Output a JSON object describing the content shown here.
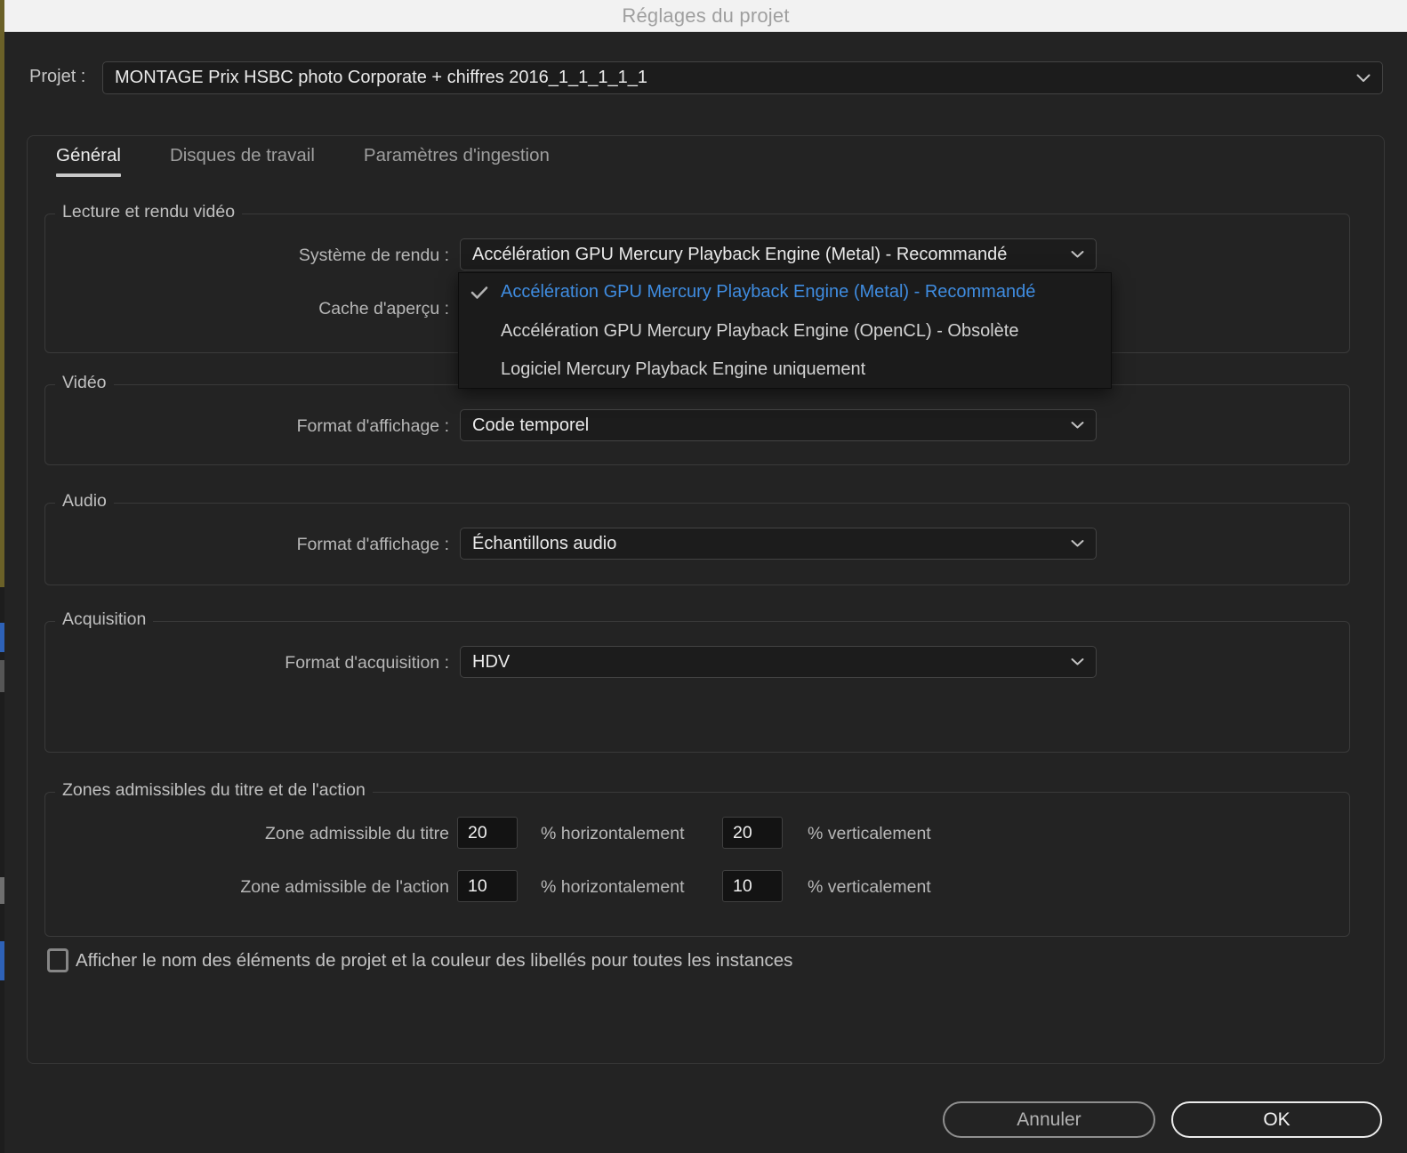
{
  "window": {
    "title": "Réglages du projet"
  },
  "project": {
    "label": "Projet :",
    "value": "MONTAGE Prix HSBC photo Corporate + chiffres 2016_1_1_1_1_1"
  },
  "tabs": [
    {
      "label": "Général",
      "active": true
    },
    {
      "label": "Disques de travail",
      "active": false
    },
    {
      "label": "Paramètres d'ingestion",
      "active": false
    }
  ],
  "playback": {
    "legend": "Lecture et rendu vidéo",
    "renderer_label": "Système de rendu :",
    "renderer_value": "Accélération GPU Mercury Playback Engine (Metal) - Recommandé",
    "cache_label": "Cache d'aperçu :"
  },
  "renderer_menu": {
    "items": [
      {
        "label": "Accélération GPU Mercury Playback Engine (Metal) - Recommandé",
        "selected": true
      },
      {
        "label": "Accélération GPU Mercury Playback Engine (OpenCL) - Obsolète",
        "selected": false
      },
      {
        "label": "Logiciel Mercury Playback Engine uniquement",
        "selected": false
      }
    ]
  },
  "video": {
    "legend": "Vidéo",
    "display_label": "Format d'affichage :",
    "display_value": "Code temporel"
  },
  "audio": {
    "legend": "Audio",
    "display_label": "Format d'affichage :",
    "display_value": "Échantillons audio"
  },
  "capture": {
    "legend": "Acquisition",
    "format_label": "Format d'acquisition :",
    "format_value": "HDV"
  },
  "safe_zones": {
    "legend": "Zones admissibles du titre et de l'action",
    "rows": [
      {
        "label": "Zone admissible du titre",
        "h_value": "20",
        "h_suffix": "% horizontalement",
        "v_value": "20",
        "v_suffix": "% verticalement"
      },
      {
        "label": "Zone admissible de l'action",
        "h_value": "10",
        "h_suffix": "% horizontalement",
        "v_value": "10",
        "v_suffix": "% verticalement"
      }
    ]
  },
  "display_names_checkbox": {
    "label": "Afficher le nom des éléments de projet et la couleur des libellés pour toutes les instances",
    "checked": false
  },
  "buttons": {
    "cancel": "Annuler",
    "ok": "OK"
  },
  "colors": {
    "dialog-bg": "#232323",
    "accent-blue": "#3f8ce0",
    "select-bg": "#1c1c1c",
    "menu-bg": "#1b1b1b"
  }
}
